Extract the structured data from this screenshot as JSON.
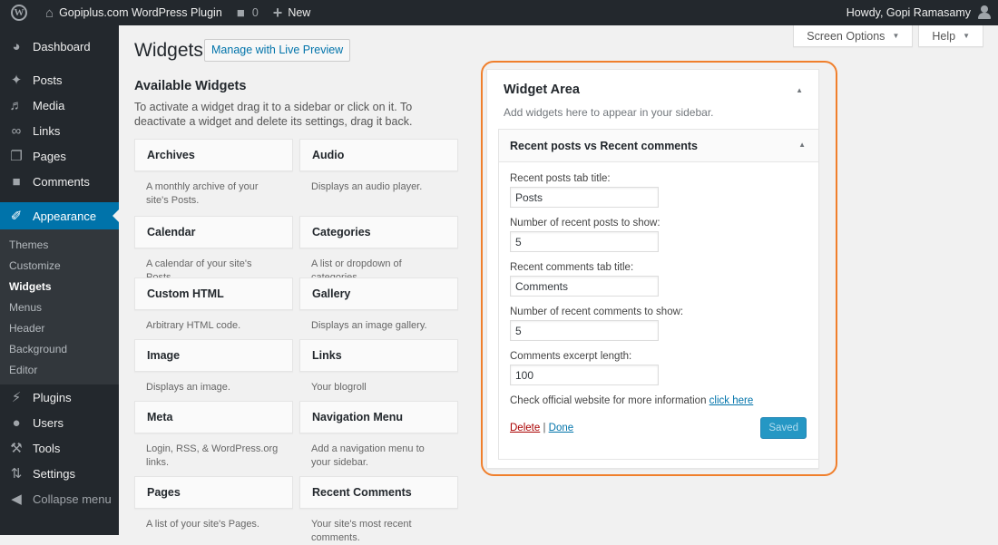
{
  "adminbar": {
    "site_name": "Gopiplus.com WordPress Plugin",
    "comments_count": "0",
    "new_label": "New",
    "greeting": "Howdy, Gopi Ramasamy"
  },
  "sidebar": {
    "items": [
      {
        "label": "Dashboard",
        "icon": "dashboard-icon"
      },
      {
        "label": "Posts",
        "icon": "pin-icon"
      },
      {
        "label": "Media",
        "icon": "media-icon"
      },
      {
        "label": "Links",
        "icon": "link-icon"
      },
      {
        "label": "Pages",
        "icon": "pages-icon"
      },
      {
        "label": "Comments",
        "icon": "comment-icon"
      },
      {
        "label": "Appearance",
        "icon": "paintbrush-icon"
      },
      {
        "label": "Plugins",
        "icon": "plug-icon"
      },
      {
        "label": "Users",
        "icon": "user-icon"
      },
      {
        "label": "Tools",
        "icon": "wrench-icon"
      },
      {
        "label": "Settings",
        "icon": "settings-icon"
      }
    ],
    "appearance_sub": [
      "Themes",
      "Customize",
      "Widgets",
      "Menus",
      "Header",
      "Background",
      "Editor"
    ],
    "collapse_label": "Collapse menu"
  },
  "screen_meta": {
    "screen_options": "Screen Options",
    "help": "Help"
  },
  "page": {
    "title": "Widgets",
    "live_preview": "Manage with Live Preview"
  },
  "available": {
    "title": "Available Widgets",
    "description": "To activate a widget drag it to a sidebar or click on it. To deactivate a widget and delete its settings, drag it back.",
    "widgets": [
      {
        "name": "Archives",
        "desc": "A monthly archive of your site's Posts."
      },
      {
        "name": "Audio",
        "desc": "Displays an audio player."
      },
      {
        "name": "Calendar",
        "desc": "A calendar of your site's Posts."
      },
      {
        "name": "Categories",
        "desc": "A list or dropdown of categories."
      },
      {
        "name": "Custom HTML",
        "desc": "Arbitrary HTML code."
      },
      {
        "name": "Gallery",
        "desc": "Displays an image gallery."
      },
      {
        "name": "Image",
        "desc": "Displays an image."
      },
      {
        "name": "Links",
        "desc": "Your blogroll"
      },
      {
        "name": "Meta",
        "desc": "Login, RSS, & WordPress.org links."
      },
      {
        "name": "Navigation Menu",
        "desc": "Add a navigation menu to your sidebar."
      },
      {
        "name": "Pages",
        "desc": "A list of your site's Pages."
      },
      {
        "name": "Recent Comments",
        "desc": "Your site's most recent comments."
      }
    ]
  },
  "widget_area": {
    "title": "Widget Area",
    "description": "Add widgets here to appear in your sidebar.",
    "widget": {
      "title": "Recent posts vs Recent comments",
      "fields": [
        {
          "label": "Recent posts tab title:",
          "value": "Posts"
        },
        {
          "label": "Number of recent posts to show:",
          "value": "5"
        },
        {
          "label": "Recent comments tab title:",
          "value": "Comments"
        },
        {
          "label": "Number of recent comments to show:",
          "value": "5"
        },
        {
          "label": "Comments excerpt length:",
          "value": "100"
        }
      ],
      "info_text": "Check official website for more information",
      "info_link": "click here",
      "delete_label": "Delete",
      "separator": "|",
      "done_label": "Done",
      "saved_label": "Saved"
    }
  },
  "colors": {
    "accent": "#0073aa",
    "highlight_border": "#f07f2c",
    "admin_dark": "#23282d"
  }
}
